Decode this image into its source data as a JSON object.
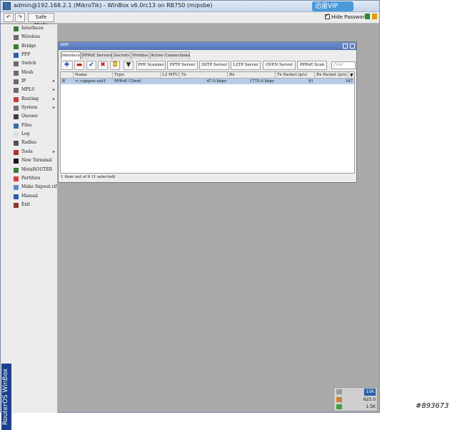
{
  "window": {
    "title": "admin@192.168.2.1 (MikroTik) - WinBox v6.0rc13 on RB750 (mipsbe)"
  },
  "overlay": {
    "vip_label": "迅雷VIP",
    "hide_passwords": "Hide Passwords",
    "watermark": "#893673"
  },
  "toolbar": {
    "undo_icon": "↶",
    "redo_icon": "↷",
    "safe_mode": "Safe Mode"
  },
  "brand": "RouterOS WinBox",
  "sidebar": {
    "items": [
      {
        "label": "Interfaces",
        "icon": "interfaces-icon",
        "color": "#3a7d3a",
        "sub": false
      },
      {
        "label": "Wireless",
        "icon": "wireless-icon",
        "color": "#6b6b6b",
        "sub": false
      },
      {
        "label": "Bridge",
        "icon": "bridge-icon",
        "color": "#3a7d3a",
        "sub": false
      },
      {
        "label": "PPP",
        "icon": "ppp-icon",
        "color": "#2d5db0",
        "sub": false
      },
      {
        "label": "Switch",
        "icon": "switch-icon",
        "color": "#6b6b6b",
        "sub": false
      },
      {
        "label": "Mesh",
        "icon": "mesh-icon",
        "color": "#6b6b6b",
        "sub": false
      },
      {
        "label": "IP",
        "icon": "ip-icon",
        "color": "#6b6b6b",
        "sub": true
      },
      {
        "label": "MPLS",
        "icon": "mpls-icon",
        "color": "#6b6b6b",
        "sub": true
      },
      {
        "label": "Routing",
        "icon": "routing-icon",
        "color": "#c04040",
        "sub": true
      },
      {
        "label": "System",
        "icon": "system-icon",
        "color": "#707070",
        "sub": true
      },
      {
        "label": "Queues",
        "icon": "queues-icon",
        "color": "#404040",
        "sub": false
      },
      {
        "label": "Files",
        "icon": "files-icon",
        "color": "#3a6ea5",
        "sub": false
      },
      {
        "label": "Log",
        "icon": "log-icon",
        "color": "#dcdcdc",
        "sub": false
      },
      {
        "label": "Radius",
        "icon": "radius-icon",
        "color": "#505050",
        "sub": false
      },
      {
        "label": "Tools",
        "icon": "tools-icon",
        "color": "#b03030",
        "sub": true
      },
      {
        "label": "New Terminal",
        "icon": "terminal-icon",
        "color": "#1a1a1a",
        "sub": false
      },
      {
        "label": "MetaROUTER",
        "icon": "metarouter-icon",
        "color": "#3a7d3a",
        "sub": false
      },
      {
        "label": "Partition",
        "icon": "partition-icon",
        "color": "#d04040",
        "sub": false
      },
      {
        "label": "Make Supout.rif",
        "icon": "supout-icon",
        "color": "#5a8ac8",
        "sub": false
      },
      {
        "label": "Manual",
        "icon": "manual-icon",
        "color": "#2d5db0",
        "sub": false
      },
      {
        "label": "Exit",
        "icon": "exit-icon",
        "color": "#8b3a2a",
        "sub": false
      }
    ]
  },
  "ppp": {
    "title": "PPP",
    "tabs": [
      "Interface",
      "PPPoE Servers",
      "Secrets",
      "Profiles",
      "Active Connections"
    ],
    "buttons": [
      "PPP Scanner",
      "PPTP Server",
      "SSTP Server",
      "L2TP Server",
      "OVPN Server",
      "PPPoE Scan"
    ],
    "find_placeholder": "Find",
    "columns": [
      "",
      "Name",
      "Type",
      "L2 MTU",
      "Tx",
      "Rx",
      "Tx Packet (p/s)",
      "Rx Packet (p/s)"
    ],
    "rows": [
      {
        "flag": "R",
        "name": "<->pppoe-out1",
        "type": "PPPoE Client",
        "l2mtu": "",
        "tx": "47.0 kbps",
        "rx": "1770.0 kbps",
        "txp": "91",
        "rxp": "167"
      }
    ],
    "status": "1 item out of 6 (1 selected)"
  },
  "tray": {
    "rows": [
      "15K",
      "625.0",
      "1.5K"
    ]
  }
}
